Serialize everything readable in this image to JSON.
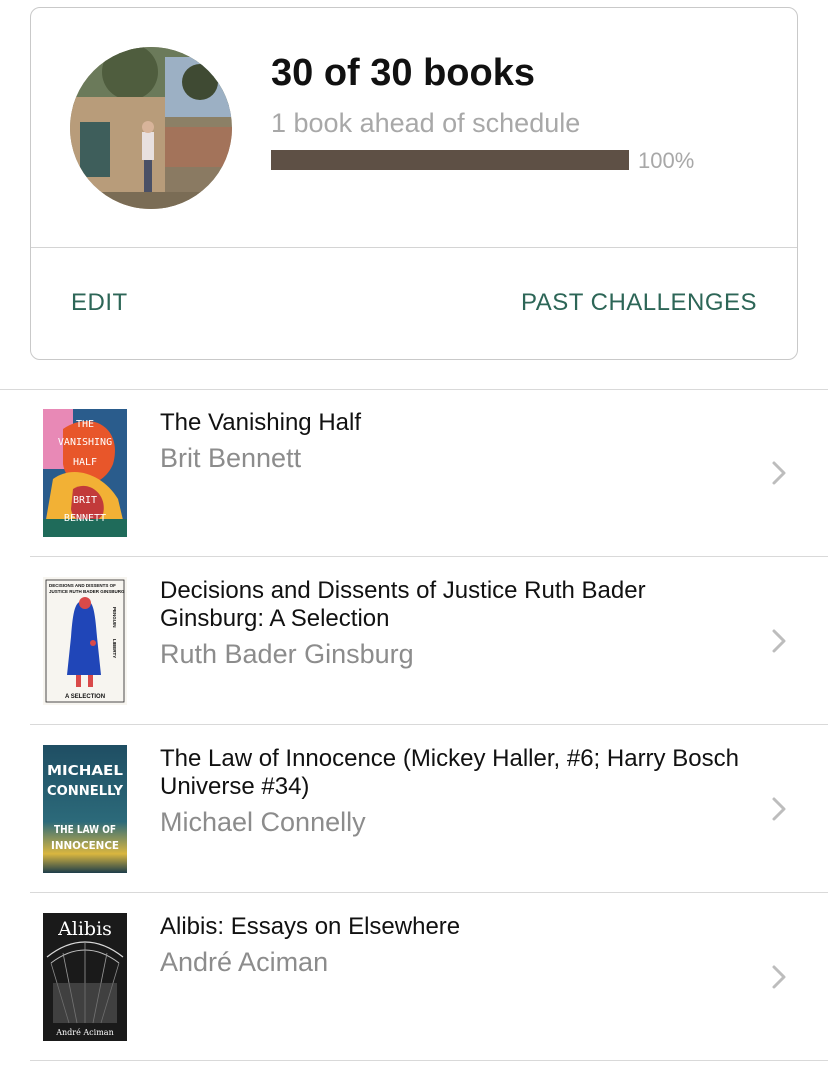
{
  "challenge": {
    "title": "30 of 30 books",
    "subtitle": "1 book ahead of schedule",
    "progress_fraction": 1.0,
    "progress_label": "100%",
    "edit_label": "EDIT",
    "past_challenges_label": "PAST CHALLENGES",
    "accent_color": "#2d6657",
    "progress_color": "#5e5045"
  },
  "books": [
    {
      "title": "The Vanishing Half",
      "author": "Brit Bennett",
      "cover_text": [
        "THE",
        "VANISHING",
        "HALF",
        "BRIT",
        "BENNETT"
      ]
    },
    {
      "title": "Decisions and Dissents of Justice Ruth Bader Ginsburg: A Selection",
      "author": "Ruth Bader Ginsburg",
      "cover_text": [
        "DECISIONS AND DISSENTS OF",
        "JUSTICE RUTH BADER GINSBURG",
        "A SELECTION",
        "PENGUIN",
        "LIBERTY"
      ]
    },
    {
      "title": "The Law of Innocence (Mickey Haller, #6; Harry Bosch Universe #34)",
      "author": "Michael Connelly",
      "cover_text": [
        "MICHAEL",
        "CONNELLY",
        "THE LAW OF",
        "INNOCENCE"
      ]
    },
    {
      "title": "Alibis: Essays on Elsewhere",
      "author": "André Aciman",
      "cover_text": [
        "Alibis",
        "André Aciman"
      ]
    }
  ],
  "icons": {
    "row_chevron": "chevron-right-icon"
  }
}
